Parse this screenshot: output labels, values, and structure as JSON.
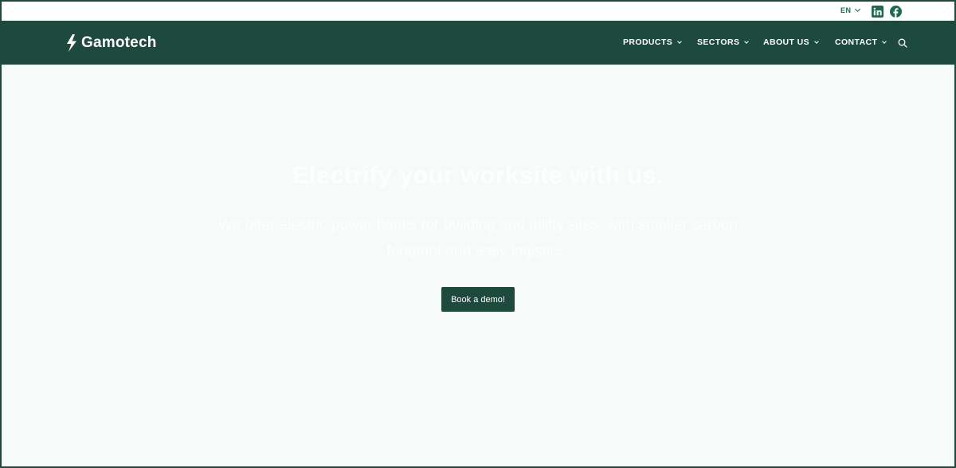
{
  "topbar": {
    "language": "EN",
    "social": [
      "linkedin-icon",
      "facebook-icon"
    ]
  },
  "header": {
    "brand": "Gamotech",
    "nav": [
      {
        "label": "PRODUCTS"
      },
      {
        "label": "SECTORS"
      },
      {
        "label": "ABOUT US"
      },
      {
        "label": "CONTACT"
      }
    ]
  },
  "hero": {
    "title": "Electrify your worksite with us.",
    "subtitle": "We offer electric power banks for building and utility sites, with smaller carbon footprint and easy logistics."
  },
  "cta": {
    "label": "Book a demo!"
  },
  "colors": {
    "brand_green": "#1d4a3c",
    "accent_green": "#1d6b4e",
    "background": "#f6faf8"
  }
}
